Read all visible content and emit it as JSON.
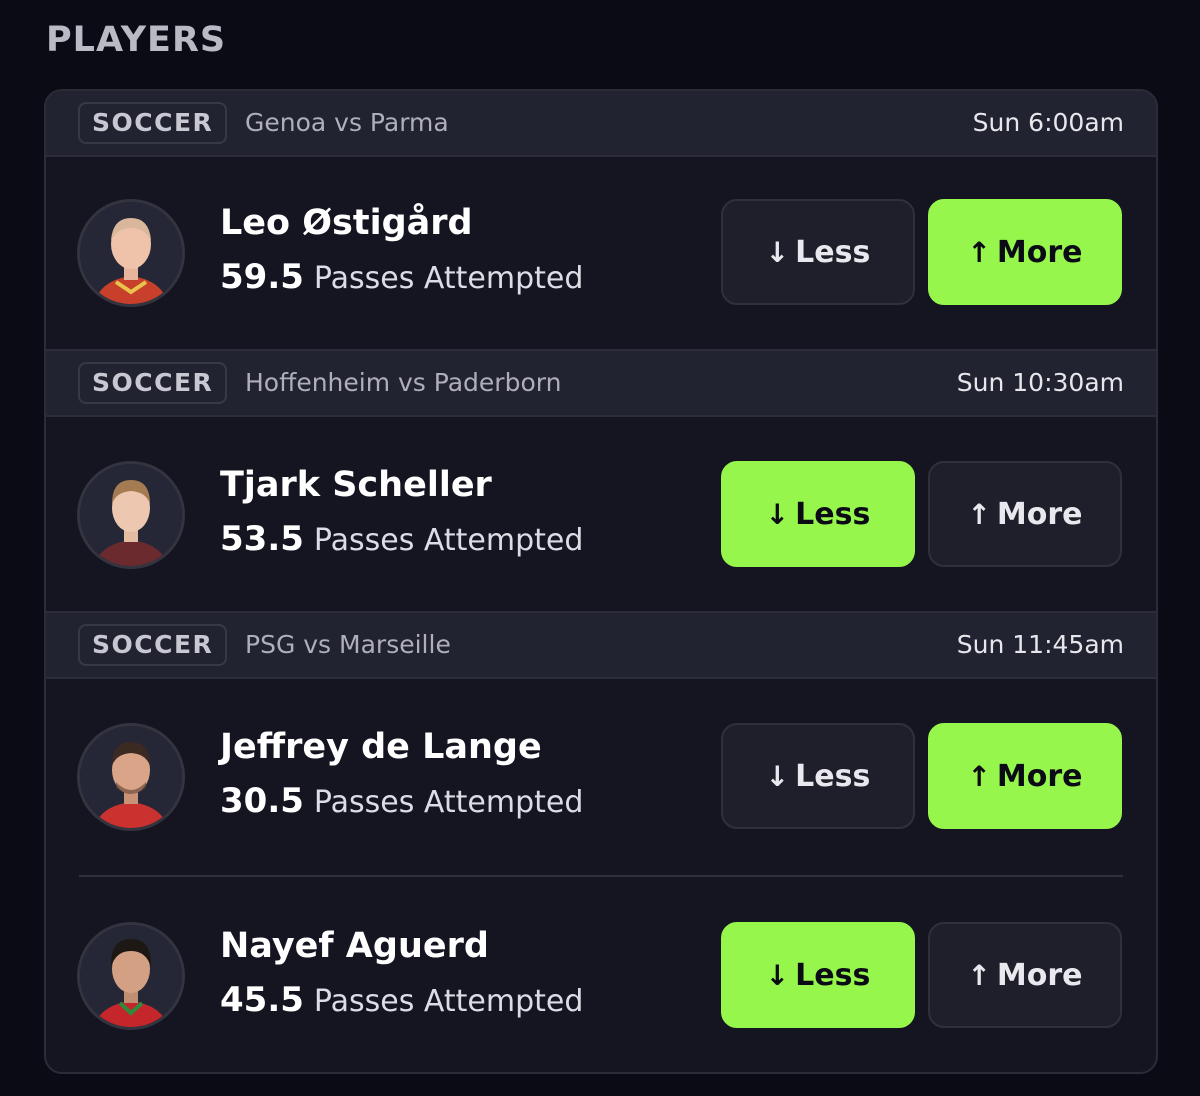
{
  "section_title": "PLAYERS",
  "colors": {
    "accent": "#96f64c",
    "background": "#0b0b16",
    "card": "#141520",
    "header": "#222330"
  },
  "games": [
    {
      "sport": "SOCCER",
      "matchup": "Genoa vs Parma",
      "time": "Sun 6:00am",
      "players": [
        {
          "name": "Leo Østigård",
          "line": "59.5",
          "stat": "Passes Attempted",
          "less_label": "Less",
          "more_label": "More",
          "less_icon": "arrow-down-icon",
          "more_icon": "arrow-up-icon",
          "selected": "more"
        }
      ]
    },
    {
      "sport": "SOCCER",
      "matchup": "Hoffenheim vs Paderborn",
      "time": "Sun 10:30am",
      "players": [
        {
          "name": "Tjark Scheller",
          "line": "53.5",
          "stat": "Passes Attempted",
          "less_label": "Less",
          "more_label": "More",
          "less_icon": "arrow-down-icon",
          "more_icon": "arrow-up-icon",
          "selected": "less"
        }
      ]
    },
    {
      "sport": "SOCCER",
      "matchup": "PSG vs Marseille",
      "time": "Sun 11:45am",
      "players": [
        {
          "name": "Jeffrey de Lange",
          "line": "30.5",
          "stat": "Passes Attempted",
          "less_label": "Less",
          "more_label": "More",
          "less_icon": "arrow-down-icon",
          "more_icon": "arrow-up-icon",
          "selected": "more"
        },
        {
          "name": "Nayef Aguerd",
          "line": "45.5",
          "stat": "Passes Attempted",
          "less_label": "Less",
          "more_label": "More",
          "less_icon": "arrow-down-icon",
          "more_icon": "arrow-up-icon",
          "selected": "less"
        }
      ]
    }
  ]
}
